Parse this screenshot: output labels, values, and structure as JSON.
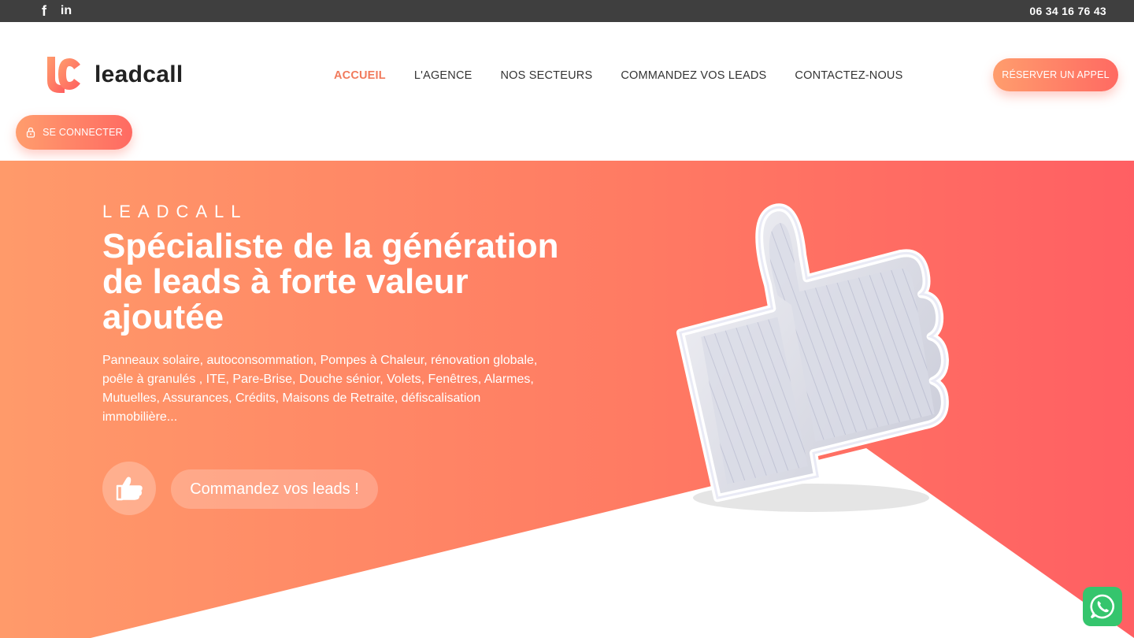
{
  "topbar": {
    "facebook_icon": "f",
    "linkedin_icon": "in",
    "phone": "06 34 16 76 43"
  },
  "header": {
    "logo_text": "leadcall",
    "nav": [
      {
        "label": "ACCUEIL",
        "active": true
      },
      {
        "label": "L'AGENCE",
        "active": false
      },
      {
        "label": "NOS SECTEURS",
        "active": false
      },
      {
        "label": "COMMANDEZ VOS LEADS",
        "active": false
      },
      {
        "label": "CONTACTEZ-NOUS",
        "active": false
      }
    ],
    "cta_label": "RÉSERVER UN APPEL",
    "login_label": "SE CONNECTER"
  },
  "hero": {
    "eyebrow": "LEADCALL",
    "title": "Spécialiste de la génération de leads à forte valeur ajoutée",
    "description": "Panneaux solaire, autoconsommation, Pompes à Chaleur, rénovation globale, poêle à granulés , ITE, Pare-Brise, Douche sénior, Volets, Fenêtres, Alarmes, Mutuelles, Assurances, Crédits, Maisons de Retraite, défiscalisation immobilière...",
    "button_label": "Commandez vos leads !"
  },
  "colors": {
    "accent": "#f17a5c",
    "gradient_start": "#ff9a6a",
    "gradient_end": "#ff5f63",
    "topbar": "#3f3f3f",
    "whatsapp": "#35c56d"
  }
}
